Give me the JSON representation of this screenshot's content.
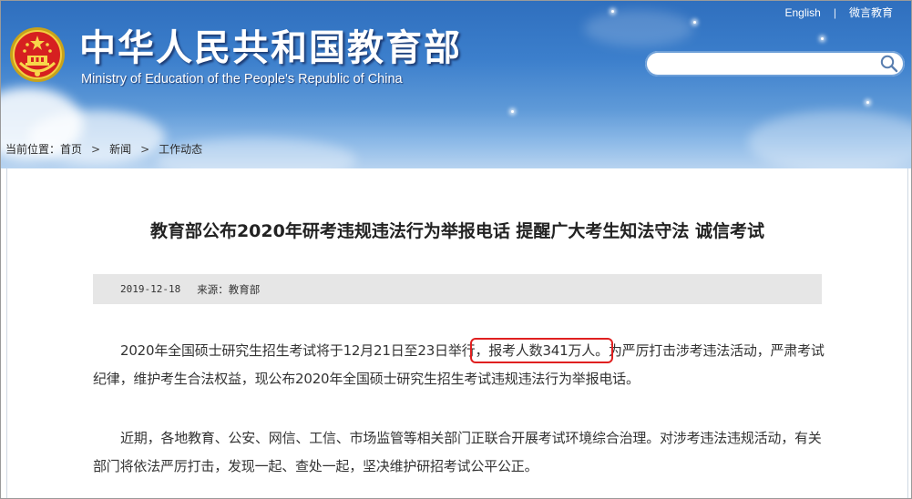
{
  "header": {
    "site_title": "中华人民共和国教育部",
    "site_subtitle": "Ministry of Education of the People's Republic of China",
    "links": {
      "english": "English",
      "separator": "|",
      "weibo": "微言教育"
    },
    "search": {
      "placeholder": "",
      "icon": "search-icon"
    },
    "emblem": "national-emblem-icon"
  },
  "breadcrumb": {
    "prefix": "当前位置：",
    "items": [
      "首页",
      "新闻",
      "工作动态"
    ],
    "separator": ">"
  },
  "article": {
    "title": "教育部公布2020年研考违规违法行为举报电话 提醒广大考生知法守法 诚信考试",
    "date": "2019-12-18",
    "source_label": "来源：教育部",
    "p1_before": "2020年全国硕士研究生招生考试将于12月21日至23日举行",
    "p1_highlight": "，报考人数341万人。",
    "p1_after": "为严厉打击涉考违法活动，严肃考试纪律，维护考生合法权益，现公布2020年全国硕士研究生招生考试违规违法行为举报电话。",
    "p2": "近期，各地教育、公安、网信、工信、市场监管等相关部门正联合开展考试环境综合治理。对涉考违法违规活动，有关部门将依法严厉打击，发现一起、查处一起，坚决维护研招考试公平公正。"
  },
  "colors": {
    "header_blue": "#3c7fcc",
    "highlight_red": "#e02020",
    "meta_bg": "#e6e6e6"
  }
}
